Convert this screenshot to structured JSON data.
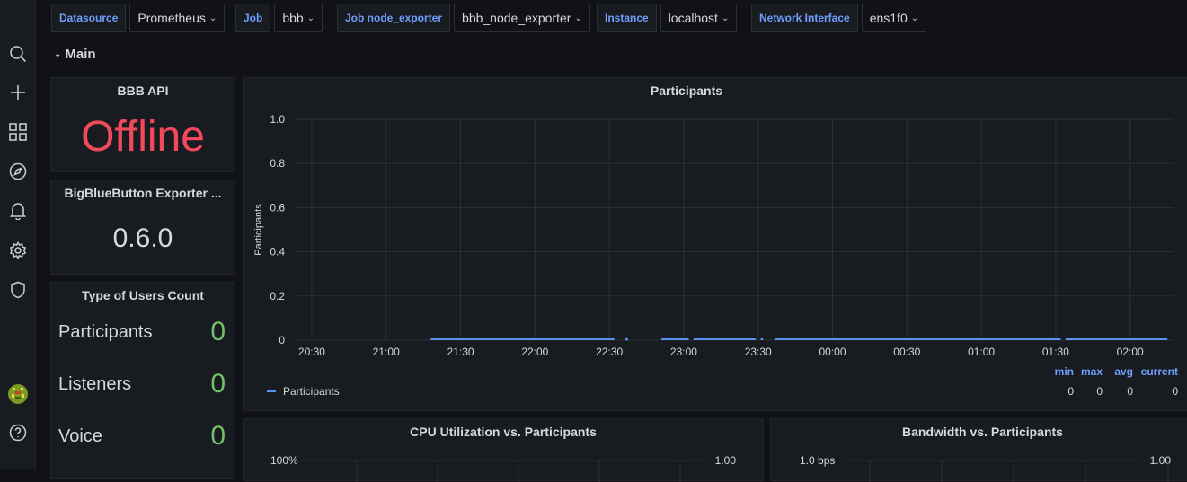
{
  "variables": [
    {
      "label": "Datasource",
      "value": "Prometheus"
    },
    {
      "label": "Job",
      "value": "bbb"
    },
    {
      "label": "Job node_exporter",
      "value": "bbb_node_exporter"
    },
    {
      "label": "Instance",
      "value": "localhost"
    },
    {
      "label": "Network Interface",
      "value": "ens1f0"
    }
  ],
  "row": {
    "title": "Main"
  },
  "api_panel": {
    "title": "BBB API",
    "value": "Offline",
    "color": "#f2495c"
  },
  "exporter_panel": {
    "title": "BigBlueButton Exporter ...",
    "value": "0.6.0"
  },
  "users_panel": {
    "title": "Type of Users Count",
    "rows": [
      {
        "label": "Participants",
        "value": "0"
      },
      {
        "label": "Listeners",
        "value": "0"
      },
      {
        "label": "Voice",
        "value": "0"
      }
    ],
    "value_color": "#73bf69"
  },
  "participants_panel": {
    "title": "Participants",
    "legend": {
      "series": "Participants",
      "headers": [
        "min",
        "max",
        "avg",
        "current"
      ],
      "values": [
        "0",
        "0",
        "0",
        "0"
      ]
    }
  },
  "cpu_panel": {
    "title": "CPU Utilization vs. Participants",
    "y_left_top": "100%",
    "y_right_top": "1.00"
  },
  "bandwidth_panel": {
    "title": "Bandwidth vs. Participants",
    "y_left_top": "1.0 bps",
    "y_right_top": "1.00"
  },
  "chart_data": {
    "type": "line",
    "title": "Participants",
    "xlabel": "",
    "ylabel": "Participants",
    "x_ticks": [
      "20:30",
      "21:00",
      "21:30",
      "22:00",
      "22:30",
      "23:00",
      "23:30",
      "00:00",
      "00:30",
      "01:00",
      "01:30",
      "02:00"
    ],
    "y_ticks": [
      "0",
      "0.2",
      "0.4",
      "0.6",
      "0.8",
      "1.0"
    ],
    "ylim": [
      0,
      1
    ],
    "grid": true,
    "legend_position": "bottom",
    "series": [
      {
        "name": "Participants",
        "color": "#5794f2",
        "segments": [
          {
            "start": "21:18",
            "end": "22:32",
            "value": 0
          },
          {
            "start": "22:37",
            "end": "22:37",
            "value": 0
          },
          {
            "start": "22:51",
            "end": "23:02",
            "value": 0
          },
          {
            "start": "23:04",
            "end": "23:29",
            "value": 0
          },
          {
            "start": "23:31",
            "end": "23:32",
            "value": 0
          },
          {
            "start": "23:37",
            "end": "01:32",
            "value": 0
          },
          {
            "start": "01:34",
            "end": "02:15",
            "value": 0
          }
        ]
      }
    ]
  }
}
